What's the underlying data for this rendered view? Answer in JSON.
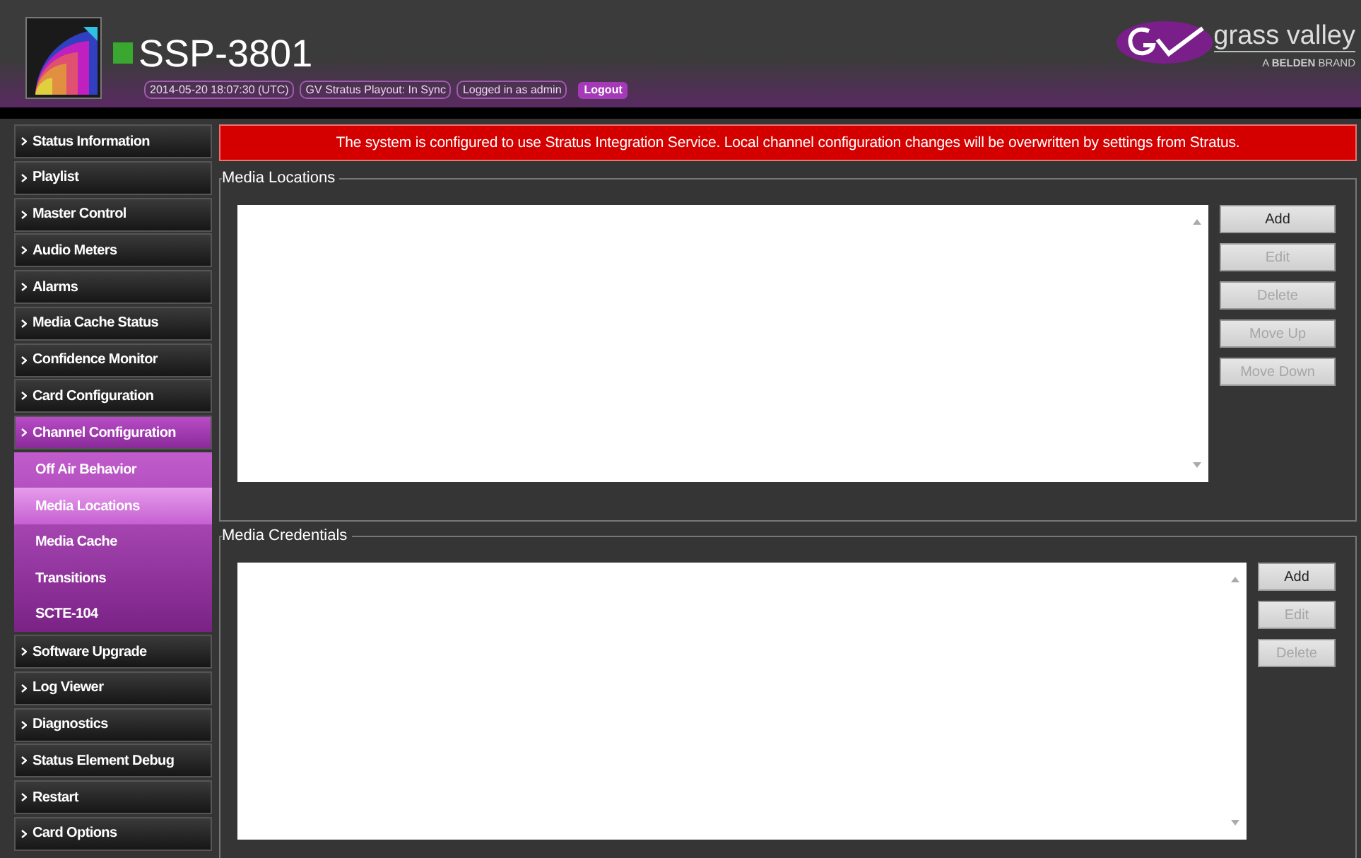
{
  "header": {
    "title": "SSP-3801",
    "status_ok": true,
    "info": [
      "2014-05-20 18:07:30 (UTC)",
      "GV Stratus Playout: In Sync",
      "Logged in as admin"
    ],
    "logout_button": "Logout",
    "brand": "grass valley",
    "tagline": "A **BELDEN** BRAND"
  },
  "sidebar": {
    "items": [
      {
        "label": "Status Information",
        "selected": false
      },
      {
        "label": "Playlist",
        "selected": false
      },
      {
        "label": "Master Control",
        "selected": false
      },
      {
        "label": "Audio Meters",
        "selected": false
      },
      {
        "label": "Alarms",
        "selected": false
      },
      {
        "label": "Media Cache Status",
        "selected": false
      },
      {
        "label": "Confidence Monitor",
        "selected": false
      },
      {
        "label": "Card Configuration",
        "selected": false
      },
      {
        "label": "Channel Configuration",
        "selected": true,
        "children": [
          {
            "label": "Off Air Behavior",
            "selected": false
          },
          {
            "label": "Media Locations",
            "selected": true
          },
          {
            "label": "Media Cache",
            "selected": false
          },
          {
            "label": "Transitions",
            "selected": false
          },
          {
            "label": "SCTE-104",
            "selected": false
          }
        ]
      },
      {
        "label": "Software Upgrade",
        "selected": false
      },
      {
        "label": "Log Viewer",
        "selected": false
      },
      {
        "label": "Diagnostics",
        "selected": false
      },
      {
        "label": "Status Element Debug",
        "selected": false
      },
      {
        "label": "Restart",
        "selected": false
      },
      {
        "label": "Card Options",
        "selected": false
      }
    ]
  },
  "alert": "The system is configured to use Stratus Integration Service. Local channel configuration changes will be overwritten by settings from Stratus.",
  "panels": [
    {
      "title": "Media Locations",
      "buttons": [
        {
          "label": "Add",
          "disabled": false
        },
        {
          "label": "Edit",
          "disabled": true
        },
        {
          "label": "Delete",
          "disabled": true
        },
        {
          "label": "Move Up",
          "disabled": true
        },
        {
          "label": "Move Down",
          "disabled": true
        }
      ]
    },
    {
      "title": "Media Credentials",
      "buttons": [
        {
          "label": "Add",
          "disabled": false
        },
        {
          "label": "Edit",
          "disabled": true
        },
        {
          "label": "Delete",
          "disabled": true
        }
      ]
    }
  ]
}
